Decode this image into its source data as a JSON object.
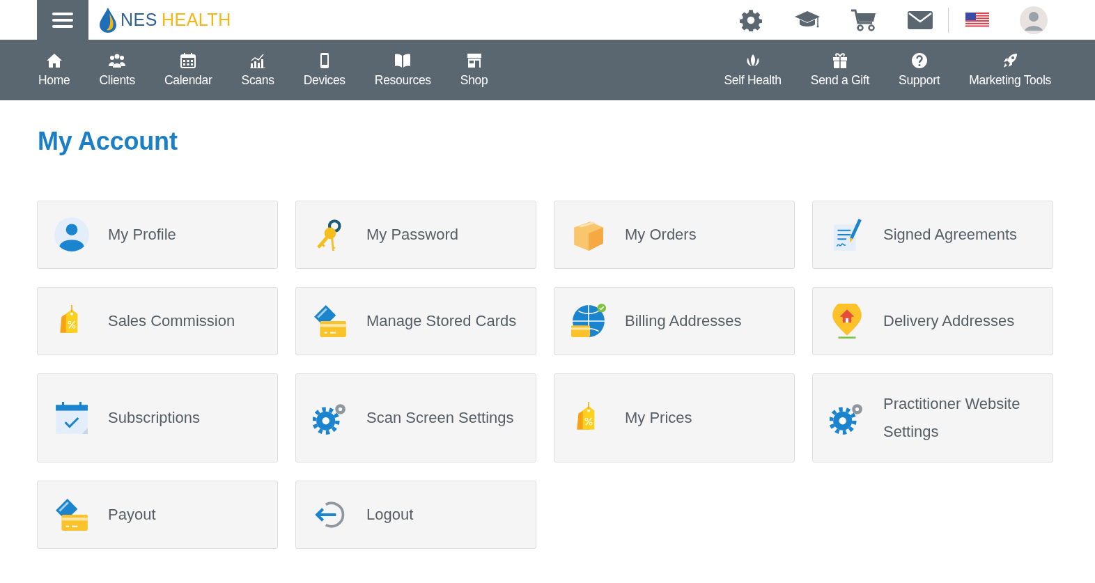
{
  "header": {
    "brand": [
      "NES",
      "HEALTH"
    ],
    "tools": [
      {
        "kind": "gear"
      },
      {
        "kind": "cap"
      },
      {
        "kind": "cart"
      },
      {
        "kind": "mail"
      },
      {
        "kind": "flag"
      },
      {
        "kind": "avatar"
      }
    ]
  },
  "nav": {
    "left": [
      {
        "label": "Home",
        "kind": "home"
      },
      {
        "label": "Clients",
        "kind": "people"
      },
      {
        "label": "Calendar",
        "kind": "calendar"
      },
      {
        "label": "Scans",
        "kind": "chart"
      },
      {
        "label": "Devices",
        "kind": "phone"
      },
      {
        "label": "Resources",
        "kind": "book"
      },
      {
        "label": "Shop",
        "kind": "store"
      }
    ],
    "right": [
      {
        "label": "Self Health",
        "kind": "lotus"
      },
      {
        "label": "Send a Gift",
        "kind": "gift"
      },
      {
        "label": "Support",
        "kind": "help"
      },
      {
        "label": "Marketing Tools",
        "kind": "rocket"
      }
    ]
  },
  "page_title": "My Account",
  "tiles": [
    {
      "label": "My Profile",
      "kind": "profile"
    },
    {
      "label": "My Password",
      "kind": "keys"
    },
    {
      "label": "My Orders",
      "kind": "box"
    },
    {
      "label": "Signed Agreements",
      "kind": "document"
    },
    {
      "label": "Sales Commission",
      "kind": "tag"
    },
    {
      "label": "Manage Stored Cards",
      "kind": "cards"
    },
    {
      "label": "Billing Addresses",
      "kind": "globe"
    },
    {
      "label": "Delivery Addresses",
      "kind": "pin"
    },
    {
      "label": "Subscriptions",
      "kind": "calendar"
    },
    {
      "label": "Scan Screen Settings",
      "kind": "gears"
    },
    {
      "label": "My Prices",
      "kind": "tag"
    },
    {
      "label": "Practitioner Website Settings",
      "kind": "gears"
    },
    {
      "label": "Payout",
      "kind": "cards"
    },
    {
      "label": "Logout",
      "kind": "logout"
    }
  ]
}
